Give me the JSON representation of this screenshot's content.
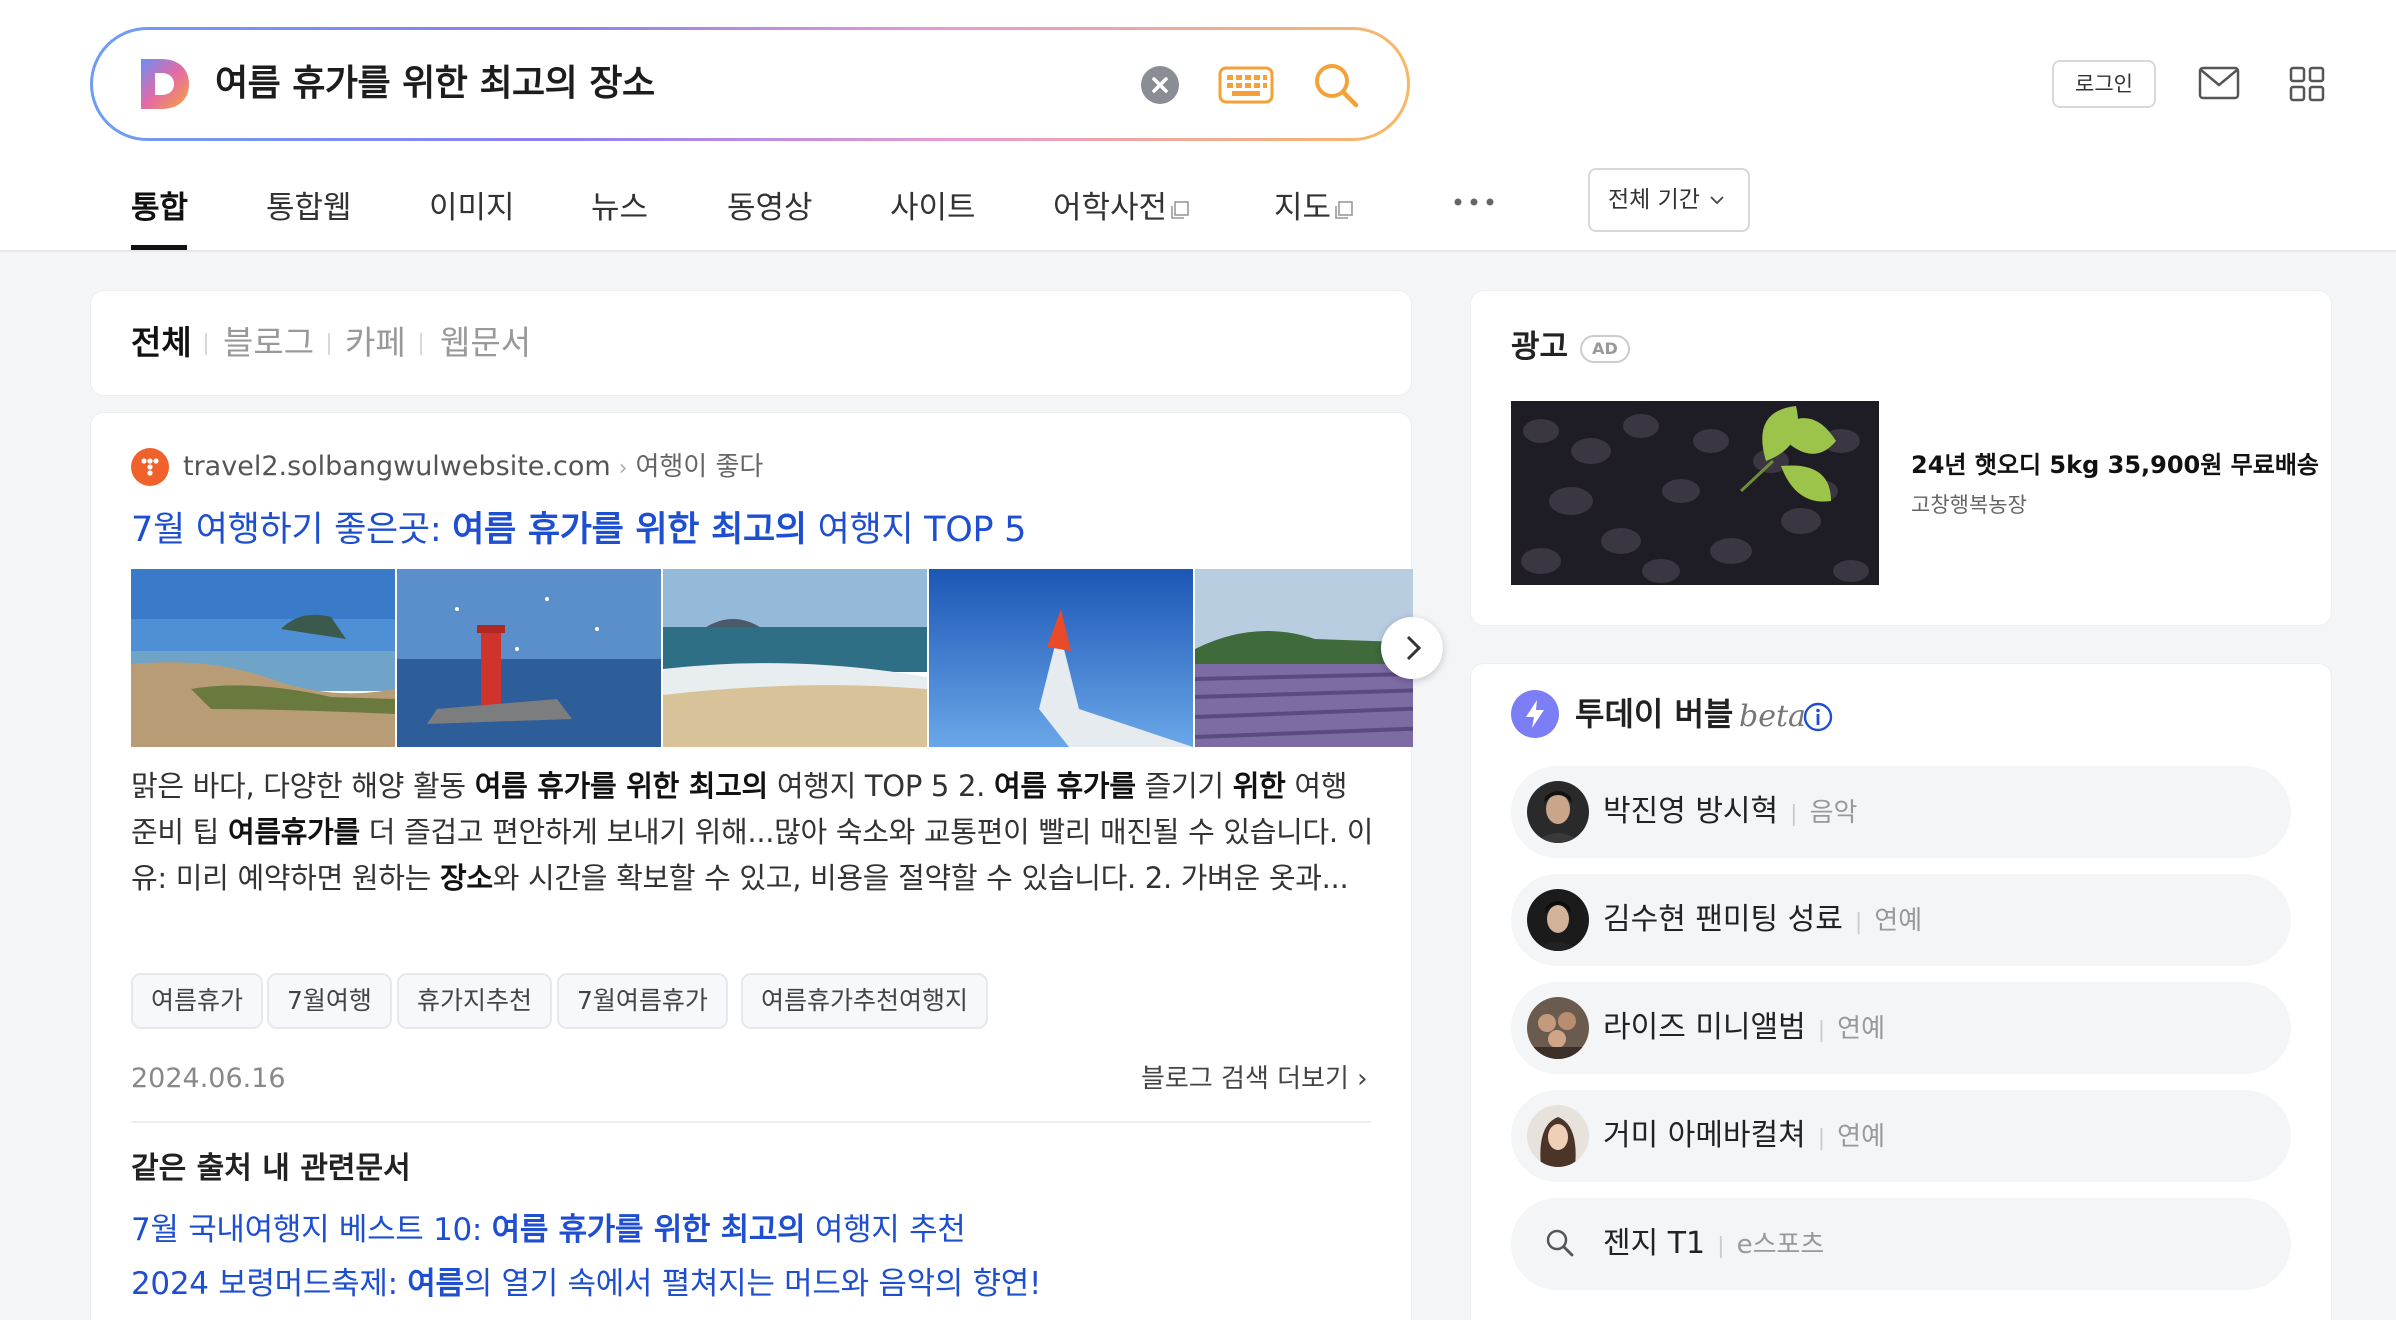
{
  "search": {
    "query": "여름 휴가를 위한 최고의 장소"
  },
  "header": {
    "login_label": "로그인"
  },
  "tabs": [
    {
      "label": "통합",
      "active": true
    },
    {
      "label": "통합웹"
    },
    {
      "label": "이미지"
    },
    {
      "label": "뉴스"
    },
    {
      "label": "동영상"
    },
    {
      "label": "사이트"
    },
    {
      "label": "어학사전"
    },
    {
      "label": "지도"
    }
  ],
  "period_filter": "전체 기간",
  "content_filter": {
    "items": [
      "전체",
      "블로그",
      "카페",
      "웹문서"
    ]
  },
  "result": {
    "source_url": "travel2.solbangwulwebsite.com",
    "source_category": "여행이 좋다",
    "title_prefix": "7월 여행하기 좋은곳: ",
    "title_bold": "여름 휴가를 위한 최고의",
    "title_suffix": " 여행지 TOP 5",
    "snippet": [
      {
        "t": "맑은 바다, 다양한 해양 활동 ",
        "b": false
      },
      {
        "t": "여름 휴가를 위한 최고의",
        "b": true
      },
      {
        "t": " 여행지 TOP 5 2. ",
        "b": false
      },
      {
        "t": "여름 휴가를",
        "b": true
      },
      {
        "t": " 즐기기 ",
        "b": false
      },
      {
        "t": "위한",
        "b": true
      },
      {
        "t": " 여행 준비 팁 ",
        "b": false
      },
      {
        "t": "여름휴가를",
        "b": true
      },
      {
        "t": " 더 즐겁고 편안하게 보내기 위해...많아 숙소와 교통편이 빨리 매진될 수 있습니다. 이유: 미리 예약하면 원하는 ",
        "b": false
      },
      {
        "t": "장소",
        "b": true
      },
      {
        "t": "와 시간을 확보할 수 있고, 비용을 절약할 수 있습니다. 2. 가벼운 옷과...",
        "b": false
      }
    ],
    "tags": [
      "여름휴가",
      "7월여행",
      "휴가지추천",
      "7월여름휴가",
      "여름휴가추천여행지"
    ],
    "date": "2024.06.16",
    "blog_more_label": "블로그 검색 더보기",
    "related_heading": "같은 출처 내 관련문서",
    "related": [
      {
        "prefix": "7월 국내여행지 베스트 10: ",
        "bold": "여름 휴가를 위한 최고의",
        "suffix": " 여행지 추천"
      },
      {
        "prefix": "2024 보령머드축제: ",
        "bold": "여름",
        "suffix": "의 열기 속에서 펼쳐지는 머드와 음악의 향연!"
      }
    ]
  },
  "ad": {
    "label": "광고",
    "badge": "AD",
    "title": "24년 햇오디 5kg 35,900원 무료배송",
    "seller": "고창행복농장"
  },
  "today_bubble": {
    "title": "투데이 버블",
    "beta": "beta",
    "items": [
      {
        "name": "박진영 방시혁",
        "category": "음악"
      },
      {
        "name": "김수현 팬미팅 성료",
        "category": "연예"
      },
      {
        "name": "라이즈 미니앨범",
        "category": "연예"
      },
      {
        "name": "거미 아메바컬쳐",
        "category": "연예"
      },
      {
        "name": "젠지 T1",
        "category": "e스포츠"
      }
    ]
  },
  "colors": {
    "link": "#1f4fd1",
    "accent_orange": "#f5a13a",
    "bubble_purple": "#7b7ef5"
  }
}
